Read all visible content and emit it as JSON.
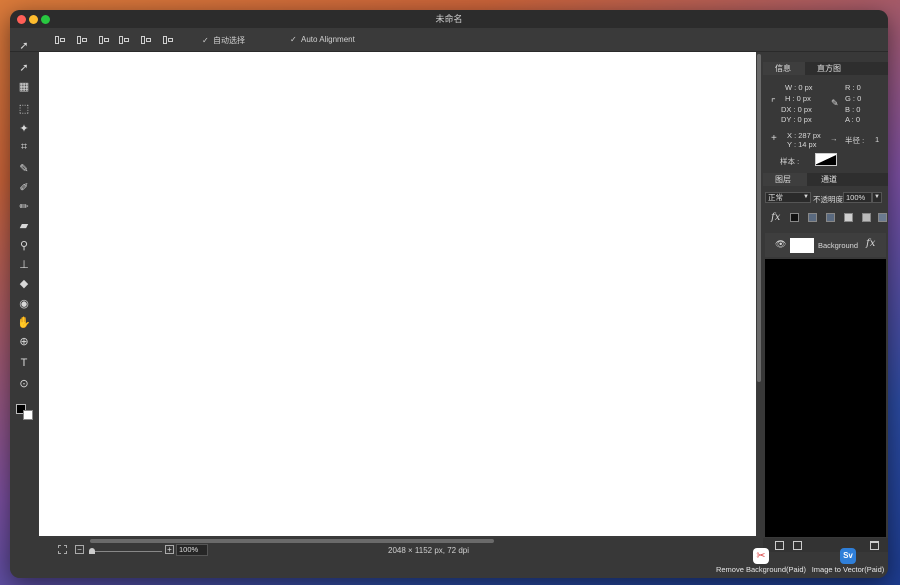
{
  "window": {
    "title": "未命名"
  },
  "options": {
    "auto_select_label": "自动选择",
    "auto_alignment_label": "Auto Alignment"
  },
  "status": {
    "zoom": "100%",
    "doc_info": "2048 × 1152 px, 72 dpi"
  },
  "info_panel": {
    "tabs": [
      "信息",
      "直方图"
    ],
    "w": "W : 0 px",
    "h": "H : 0 px",
    "dx": "DX : 0 px",
    "dy": "DY : 0 px",
    "r": "R : 0",
    "g": "G : 0",
    "b": "B : 0",
    "a": "A : 0",
    "x": "X : 287 px",
    "y": "Y : 14 px",
    "radius_label": "半径 :",
    "radius_value": "1",
    "sample_label": "样本 :"
  },
  "layers_panel": {
    "tabs": [
      "图层",
      "通道"
    ],
    "blend_mode": "正常",
    "opacity_label": "不透明度",
    "opacity_value": "100%",
    "fx_label": "fx",
    "layer_name": "Background"
  },
  "promos": {
    "remove_bg": "Remove Background(Paid)",
    "to_vector": "Image to Vector(Paid)",
    "to_vector_icon": "Sv"
  },
  "colors": {
    "accent_red": "#d93a3a",
    "accent_blue": "#2f7fd9"
  }
}
